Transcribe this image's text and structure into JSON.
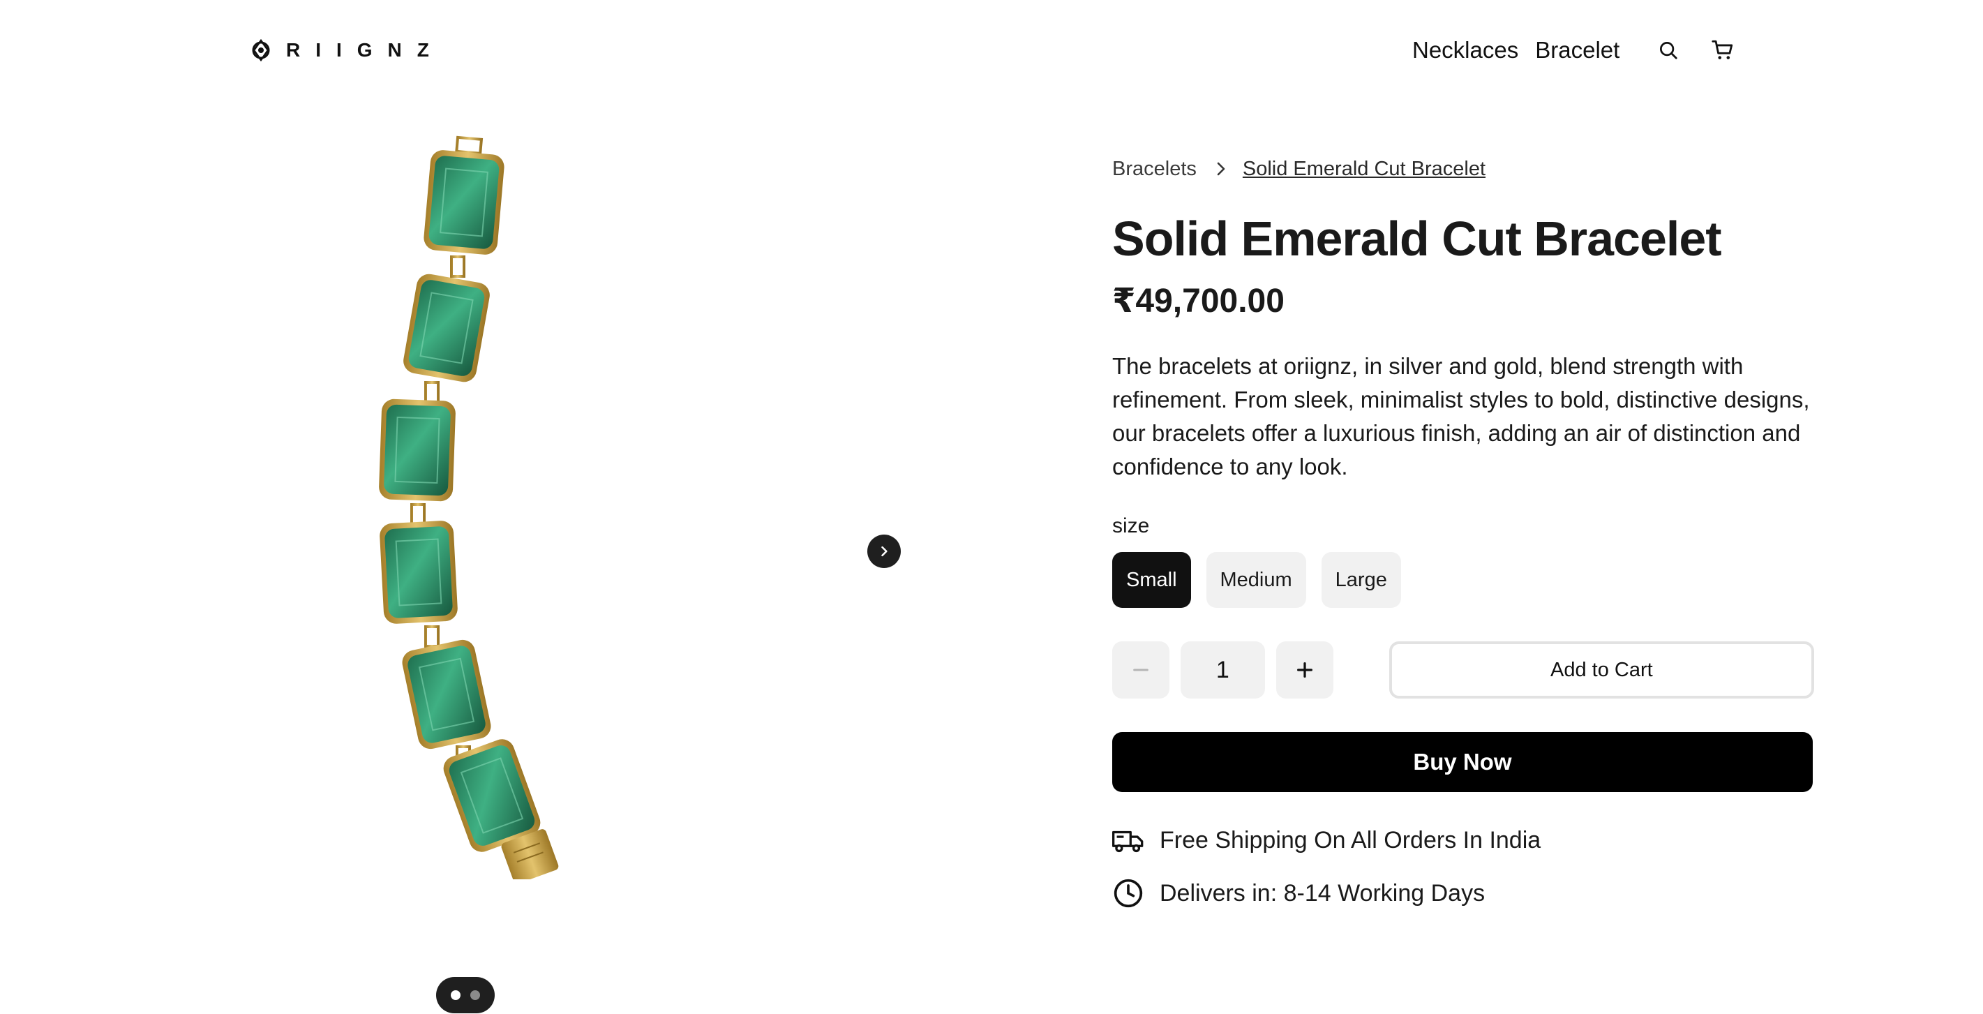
{
  "header": {
    "logo_text": "RIIGNZ",
    "nav": [
      {
        "label": "Necklaces"
      },
      {
        "label": "Bracelet"
      }
    ]
  },
  "gallery": {
    "current_slide": 1,
    "total_slides": 2
  },
  "breadcrumb": {
    "parent": "Bracelets",
    "current": "Solid Emerald Cut Bracelet"
  },
  "product": {
    "title": "Solid Emerald Cut Bracelet",
    "price": "₹49,700.00",
    "description": "The bracelets at oriignz, in silver and gold, blend strength with refinement. From sleek, minimalist styles to bold, distinctive designs, our bracelets offer a luxurious finish, adding an air of distinction and confidence to any look.",
    "size_label": "size",
    "sizes": [
      {
        "label": "Small",
        "selected": true
      },
      {
        "label": "Medium",
        "selected": false
      },
      {
        "label": "Large",
        "selected": false
      }
    ],
    "quantity": "1",
    "add_to_cart_label": "Add to Cart",
    "buy_now_label": "Buy Now"
  },
  "perks": {
    "shipping": "Free Shipping On All Orders In India",
    "delivery": "Delivers in: 8-14 Working Days"
  },
  "colors": {
    "emerald": "#2e9e74",
    "gold": "#c9a54a",
    "dark": "#111111"
  }
}
